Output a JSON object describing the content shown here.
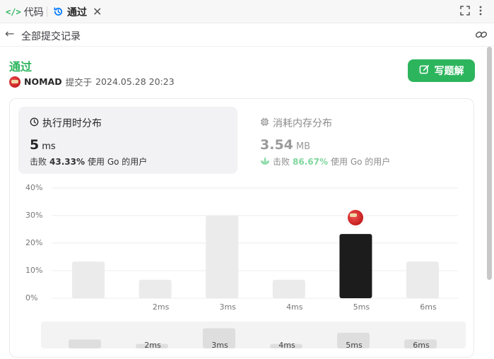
{
  "tabs": {
    "code_label": "代码",
    "code_icon": "code-brackets-icon",
    "passed_label": "通过",
    "passed_icon": "history-clock-icon",
    "close_glyph": "✕"
  },
  "subbar": {
    "back_glyph": "←",
    "all_submissions": "全部提交记录"
  },
  "submission": {
    "status": "通过",
    "username": "NOMAD",
    "submitted_at_prefix": "提交于",
    "submitted_at": "2024.05.28 20:23"
  },
  "write_solution_label": "写题解",
  "runtime_card": {
    "title": "执行用时分布",
    "value": "5",
    "unit": "ms",
    "beat_prefix": "击败",
    "beat_percent": "43.33%",
    "beat_suffix": "使用 Go 的用户"
  },
  "memory_card": {
    "title": "消耗内存分布",
    "value": "3.54",
    "unit": "MB",
    "beat_prefix": "击败",
    "beat_percent": "86.67%",
    "beat_suffix": "使用 Go 的用户"
  },
  "colors": {
    "accent_green": "#2db55d",
    "link_blue": "#007aff",
    "bar_default": "#ebebeb",
    "bar_highlight": "#1c1c1c"
  },
  "chart_data": {
    "type": "bar",
    "title": "",
    "xlabel": "",
    "ylabel": "",
    "y_ticks": [
      "40%",
      "30%",
      "20%",
      "10%",
      "0%"
    ],
    "ylim": [
      0,
      40
    ],
    "grid": true,
    "categories": [
      "",
      "2ms",
      "3ms",
      "4ms",
      "5ms",
      "6ms"
    ],
    "values": [
      13.3,
      6.7,
      30.0,
      6.7,
      23.3,
      13.3
    ],
    "highlight_category": "5ms",
    "overview_labels": [
      "2ms",
      "3ms",
      "4ms",
      "5ms",
      "6ms"
    ]
  }
}
